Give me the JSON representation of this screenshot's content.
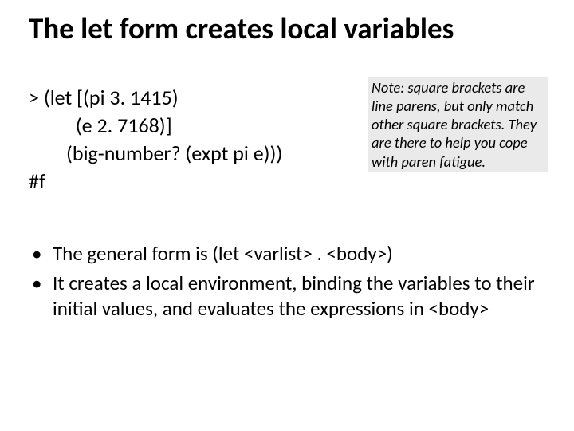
{
  "title": "The let form creates local variables",
  "code": {
    "line1": "> (let [(pi 3. 1415)",
    "line2": "          (e 2. 7168)]",
    "line3": "        (big-number? (expt pi e)))",
    "line4": "#f"
  },
  "note": "Note: square brackets are line parens, but only match other square brackets. They are there to help you cope with paren fatigue.",
  "bullets": [
    "The general form is (let <varlist> . <body>)",
    "It creates a local environment, binding the variables to their initial values, and evaluates the expressions in <body>"
  ]
}
